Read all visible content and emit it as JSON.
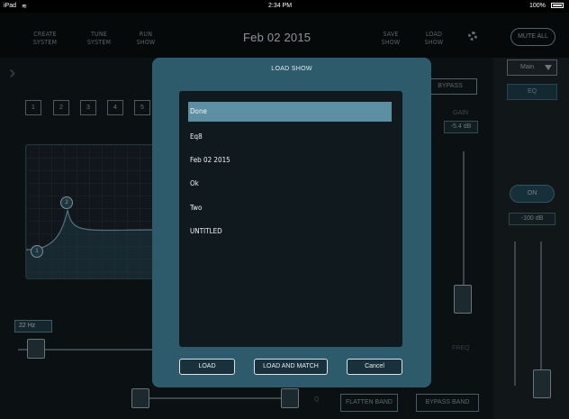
{
  "status_bar": {
    "device": "iPad",
    "time": "2:34 PM",
    "battery": "100%"
  },
  "nav": {
    "create_system": "CREATE\nSYSTEM",
    "tune_system": "TUNE\nSYSTEM",
    "run_show": "RUN\nSHOW",
    "title": "Feb 02 2015",
    "save_show": "SAVE\nSHOW",
    "load_show": "LOAD\nSHOW",
    "mute_all": "MUTE ALL",
    "settings_icon": "gear-icon"
  },
  "eq": {
    "band_numbers": [
      "1",
      "2",
      "3",
      "4",
      "5"
    ],
    "node_labels": [
      "1",
      "2"
    ],
    "freq_value": "22 Hz",
    "bypass": "BYPASS",
    "gain_label": "GAIN",
    "gain_value": "-5.4 dB",
    "freq_label": "FREQ",
    "q_label": "Q",
    "flatten_band": "FLATTEN BAND",
    "bypass_band": "BYPASS BAND"
  },
  "right_panel": {
    "output_select": "Main",
    "eq_button": "EQ",
    "on_button": "ON",
    "level_value": "-100 dB"
  },
  "modal": {
    "title": "LOAD SHOW",
    "items": [
      {
        "label": "Done",
        "selected": true
      },
      {
        "label": "Eq8",
        "selected": false
      },
      {
        "label": "Feb 02 2015",
        "selected": false
      },
      {
        "label": "Ok",
        "selected": false
      },
      {
        "label": "Two",
        "selected": false
      },
      {
        "label": "UNTITLED",
        "selected": false
      }
    ],
    "load_button": "LOAD",
    "load_match_button": "LOAD AND MATCH",
    "cancel_button": "Cancel"
  },
  "colors": {
    "accent": "#5d8fa3",
    "modal_bg": "#2e5b6c",
    "background": "#121a1e"
  }
}
